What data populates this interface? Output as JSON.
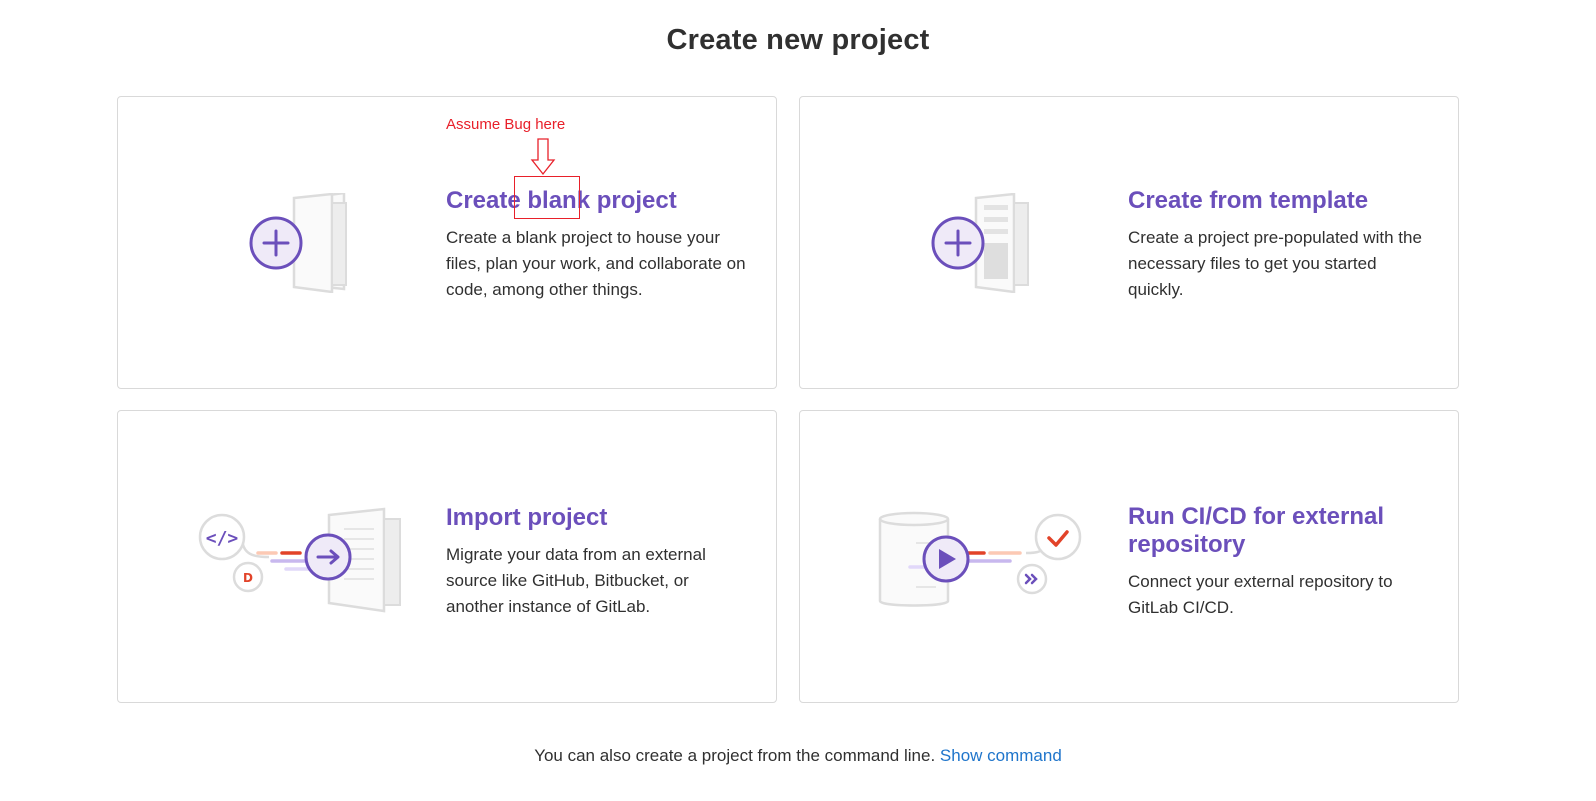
{
  "page": {
    "title": "Create new project"
  },
  "annotation": {
    "label": "Assume Bug here",
    "color": "#e8202a"
  },
  "cards": [
    {
      "title": "Create blank project",
      "description": "Create a blank project to house your files, plan your work, and collaborate on code, among other things.",
      "icon": "blank-project-illustration"
    },
    {
      "title": "Create from template",
      "description": "Create a project pre-populated with the necessary files to get you started quickly.",
      "icon": "template-project-illustration"
    },
    {
      "title": "Import project",
      "description": "Migrate your data from an external source like GitHub, Bitbucket, or another instance of GitLab.",
      "icon": "import-project-illustration"
    },
    {
      "title": "Run CI/CD for external repository",
      "description": "Connect your external repository to GitLab CI/CD.",
      "icon": "ci-cd-project-illustration"
    }
  ],
  "footer": {
    "text": "You can also create a project from the command line.",
    "link": "Show command"
  },
  "colors": {
    "accent": "#6b4fbb",
    "link": "#1f75cb",
    "orange": "#e24329"
  }
}
